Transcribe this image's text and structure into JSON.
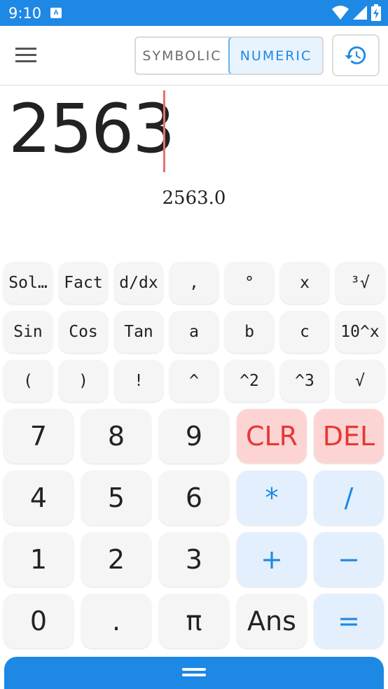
{
  "status_bar": {
    "time": "9:10",
    "notification_glyph": "A",
    "icons": [
      "wifi-icon",
      "signal-icon",
      "battery-charging-icon"
    ]
  },
  "app_bar": {
    "menu_icon": "hamburger-menu-icon",
    "mode_tabs": [
      "SYMBOLIC",
      "NUMERIC"
    ],
    "selected_mode": "NUMERIC",
    "history_icon": "history-icon"
  },
  "display": {
    "expression": "2563",
    "result": "2563.0"
  },
  "keypad": {
    "function_row_1": [
      "Sol…",
      "Fact",
      "d/dx",
      ",",
      "°",
      "x",
      "³√"
    ],
    "function_row_2": [
      "Sin",
      "Cos",
      "Tan",
      "a",
      "b",
      "c",
      "10^x"
    ],
    "function_row_3": [
      "(",
      ")",
      "!",
      "^",
      "^2",
      "^3",
      "√"
    ],
    "num_row_1": [
      "7",
      "8",
      "9",
      "CLR",
      "DEL"
    ],
    "num_row_2": [
      "4",
      "5",
      "6",
      "*",
      "/"
    ],
    "num_row_3": [
      "1",
      "2",
      "3",
      "+",
      "−"
    ],
    "num_row_4": [
      "0",
      ".",
      "π",
      "Ans",
      "="
    ]
  },
  "bottom_handle_icon": "drag-handle-icon",
  "colors": {
    "accent": "#1e88e5",
    "accent_light": "#e3effc",
    "danger": "#e53935",
    "danger_light": "#fcd4d4",
    "key_bg": "#f5f5f5",
    "cursor": "#e57373"
  }
}
